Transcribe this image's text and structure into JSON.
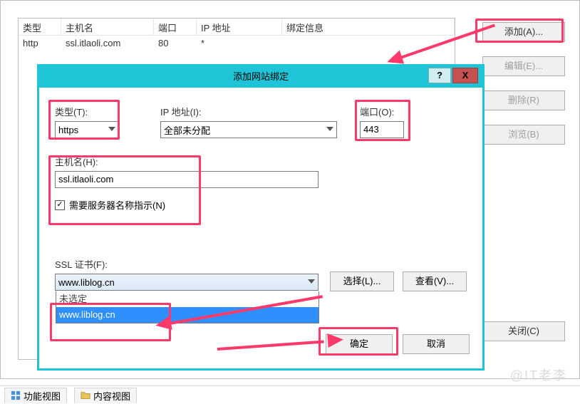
{
  "parent": {
    "columns": {
      "type": "类型",
      "host": "主机名",
      "port": "端口",
      "ip": "IP 地址",
      "bind": "绑定信息"
    },
    "row": {
      "type": "http",
      "host": "ssl.itlaoli.com",
      "port": "80",
      "ip": "*",
      "bind": ""
    },
    "buttons": {
      "add": "添加(A)...",
      "edit": "编辑(E)...",
      "remove": "删除(R)",
      "browse": "浏览(B)",
      "close": "关闭(C)"
    }
  },
  "dialog": {
    "title": "添加网站绑定",
    "help": "?",
    "close": "X",
    "labels": {
      "type": "类型(T):",
      "ip": "IP 地址(I):",
      "port": "端口(O):",
      "host": "主机名(H):",
      "sni": "需要服务器名称指示(N)",
      "ssl": "SSL 证书(F):"
    },
    "values": {
      "type": "https",
      "ip": "全部未分配",
      "port": "443",
      "host": "ssl.itlaoli.com",
      "sni_checked": "✓",
      "ssl_selected": "www.liblog.cn"
    },
    "ssl_options": {
      "none": "未选定",
      "cert": "www.liblog.cn"
    },
    "buttons": {
      "select": "选择(L)...",
      "view": "查看(V)...",
      "ok": "确定",
      "cancel": "取消"
    }
  },
  "tabs": {
    "feature": "功能视图",
    "content": "内容视图"
  },
  "watermark": "@IT老李"
}
